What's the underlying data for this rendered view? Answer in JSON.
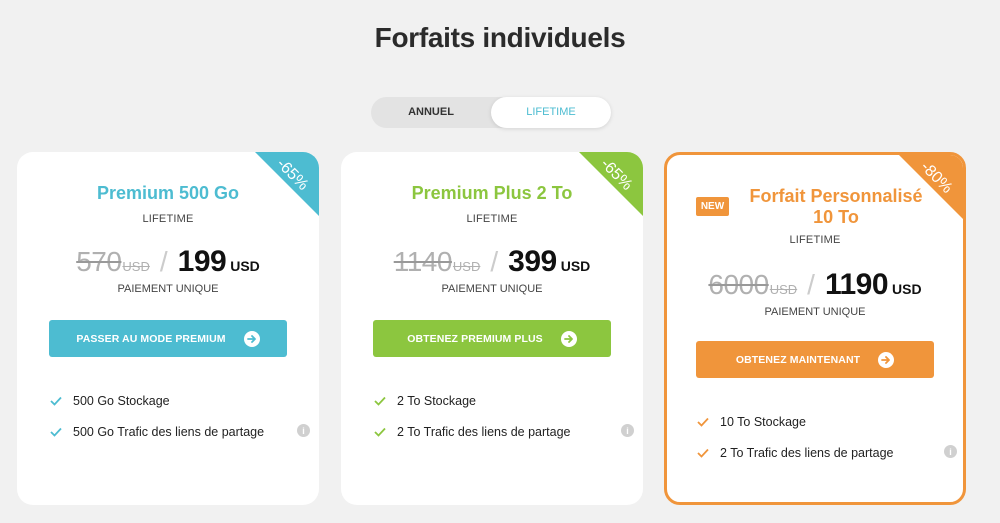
{
  "page": {
    "title": "Forfaits individuels"
  },
  "toggle": {
    "annual_label": "ANNUEL",
    "lifetime_label": "LIFETIME",
    "selected": "LIFETIME"
  },
  "colors": {
    "blue": "#4dbcd1",
    "green": "#8cc63f",
    "orange": "#f0953b"
  },
  "plans": [
    {
      "discount": "-65%",
      "name": "Premium 500 Go",
      "period": "LIFETIME",
      "old_price": "570",
      "old_currency": "USD",
      "new_price": "199",
      "new_currency": "USD",
      "payment_note": "PAIEMENT UNIQUE",
      "cta_label": "PASSER AU MODE PREMIUM",
      "features": [
        "500 Go Stockage",
        "500 Go Trafic des liens de partage"
      ]
    },
    {
      "discount": "-65%",
      "name": "Premium Plus 2 To",
      "period": "LIFETIME",
      "old_price": "1140",
      "old_currency": "USD",
      "new_price": "399",
      "new_currency": "USD",
      "payment_note": "PAIEMENT UNIQUE",
      "cta_label": "OBTENEZ PREMIUM PLUS",
      "features": [
        "2 To Stockage",
        "2 To Trafic des liens de partage"
      ]
    },
    {
      "badge": "NEW",
      "discount": "-80%",
      "name": "Forfait Personnalisé 10 To",
      "period": "LIFETIME",
      "old_price": "6000",
      "old_currency": "USD",
      "new_price": "1190",
      "new_currency": "USD",
      "payment_note": "PAIEMENT UNIQUE",
      "cta_label": "OBTENEZ MAINTENANT",
      "features": [
        "10 To Stockage",
        "2 To Trafic des liens de partage"
      ]
    }
  ]
}
